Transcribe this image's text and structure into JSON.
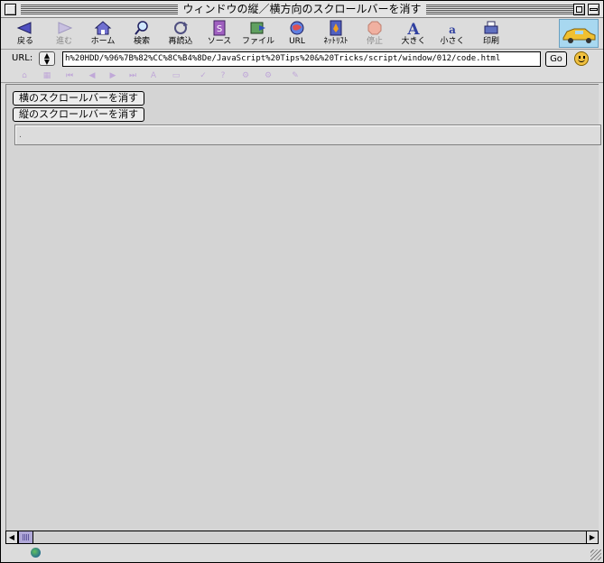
{
  "window": {
    "title": "ウィンドウの縦／横方向のスクロールバーを消す"
  },
  "toolbar": {
    "items": [
      {
        "label": "戻る",
        "icon": "back-arrow-icon",
        "enabled": true
      },
      {
        "label": "進む",
        "icon": "forward-arrow-icon",
        "enabled": false
      },
      {
        "label": "ホーム",
        "icon": "home-icon",
        "enabled": true
      },
      {
        "label": "検索",
        "icon": "search-icon",
        "enabled": true
      },
      {
        "label": "再読込",
        "icon": "reload-icon",
        "enabled": true
      },
      {
        "label": "ソース",
        "icon": "source-icon",
        "enabled": true
      },
      {
        "label": "ファイル",
        "icon": "file-icon",
        "enabled": true
      },
      {
        "label": "URL",
        "icon": "url-icon",
        "enabled": true
      },
      {
        "label": "ﾈｯﾄﾘｽﾄ",
        "icon": "netlist-icon",
        "enabled": true
      },
      {
        "label": "停止",
        "icon": "stop-icon",
        "enabled": false
      },
      {
        "label": "大きく",
        "icon": "larger-text-icon",
        "enabled": true
      },
      {
        "label": "小さく",
        "icon": "smaller-text-icon",
        "enabled": true
      },
      {
        "label": "印刷",
        "icon": "print-icon",
        "enabled": true
      }
    ]
  },
  "urlbar": {
    "label": "URL:",
    "value": "h%20HDD/%96%7B%82%CC%8C%B4%8De/JavaScript%20Tips%20&%20Tricks/script/window/012/code.html",
    "go_label": "Go"
  },
  "page": {
    "buttons": [
      {
        "label": "横のスクロールバーを消す"
      },
      {
        "label": "縦のスクロールバーを消す"
      }
    ],
    "textarea_value": "."
  },
  "colors": {
    "chrome": "#dcdcdc",
    "content": "#d4d4d4",
    "scroll_thumb": "#b0a8d8"
  }
}
